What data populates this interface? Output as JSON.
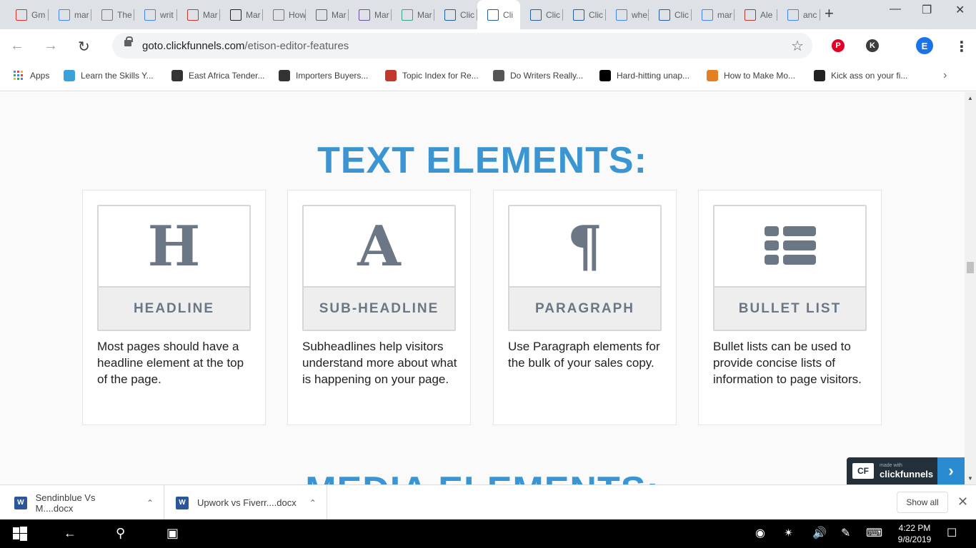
{
  "browser": {
    "tabs": [
      {
        "label": "Gm",
        "icon": "gmail-icon",
        "color": "#d93025"
      },
      {
        "label": "mar",
        "icon": "google-icon",
        "color": "#4285f4"
      },
      {
        "label": "The",
        "icon": "page-icon",
        "color": "#777777"
      },
      {
        "label": "writ",
        "icon": "google-icon",
        "color": "#4285f4"
      },
      {
        "label": "Mar",
        "icon": "site-icon",
        "color": "#c0392b"
      },
      {
        "label": "Mar",
        "icon": "site-icon",
        "color": "#222222"
      },
      {
        "label": "How",
        "icon": "page-icon",
        "color": "#777777"
      },
      {
        "label": "Mar",
        "icon": "globe-icon",
        "color": "#5f6368"
      },
      {
        "label": "Mar",
        "icon": "site-icon",
        "color": "#6b4fa0"
      },
      {
        "label": "Mar",
        "icon": "site-icon",
        "color": "#3aa28a"
      },
      {
        "label": "Clic",
        "icon": "clickfunnels-icon",
        "color": "#1f5fa8"
      },
      {
        "label": "Cli",
        "icon": "clickfunnels-icon",
        "color": "#1f5fa8",
        "active": true
      },
      {
        "label": "Clic",
        "icon": "clickfunnels-icon",
        "color": "#1f5fa8"
      },
      {
        "label": "Clic",
        "icon": "clickfunnels-icon",
        "color": "#1f5fa8"
      },
      {
        "label": "whe",
        "icon": "google-icon",
        "color": "#4285f4"
      },
      {
        "label": "Clic",
        "icon": "clickfunnels-icon",
        "color": "#1f5fa8"
      },
      {
        "label": "mar",
        "icon": "google-icon",
        "color": "#4285f4"
      },
      {
        "label": "Ale",
        "icon": "site-icon",
        "color": "#b03a2e"
      },
      {
        "label": "anc",
        "icon": "google-icon",
        "color": "#4285f4"
      }
    ],
    "url_domain": "goto.clickfunnels.com",
    "url_path": "/etison-editor-features",
    "profile_initial": "E",
    "ext_initial": "K"
  },
  "bookmarks": [
    {
      "label": "Apps",
      "icon": "apps-grid-icon",
      "color": "#4285f4"
    },
    {
      "label": "Learn the Skills Y...",
      "icon": "site-icon",
      "color": "#3aa2d8"
    },
    {
      "label": "East Africa Tender...",
      "icon": "site-icon",
      "color": "#333333"
    },
    {
      "label": "Importers Buyers...",
      "icon": "site-icon",
      "color": "#333333"
    },
    {
      "label": "Topic Index for Re...",
      "icon": "site-icon",
      "color": "#c0392b"
    },
    {
      "label": "Do Writers Really...",
      "icon": "clock-icon",
      "color": "#555555"
    },
    {
      "label": "Hard-hitting unap...",
      "icon": "m-icon",
      "color": "#000000"
    },
    {
      "label": "How to Make Mo...",
      "icon": "site-icon",
      "color": "#e67e22"
    },
    {
      "label": "Kick ass on your fi...",
      "icon": "site-icon",
      "color": "#222222"
    }
  ],
  "page": {
    "section_title": "TEXT ELEMENTS:",
    "next_section_title": "MEDIA ELEMENTS:",
    "cards": [
      {
        "glyph": "H",
        "label": "HEADLINE",
        "desc": "Most pages should have a headline element at the top of the page."
      },
      {
        "glyph": "A",
        "label": "SUB-HEADLINE",
        "desc": "Subheadlines help visitors understand more about what is happening on your page."
      },
      {
        "glyph": "¶",
        "label": "PARAGRAPH",
        "desc": "Use Paragraph elements for the bulk of your sales copy."
      },
      {
        "glyph": "list",
        "label": "BULLET LIST",
        "desc": "Bullet lists can be used to provide concise lists of information to page visitors."
      }
    ],
    "badge_made": "made with",
    "badge_name": "clickfunnels"
  },
  "downloads": {
    "items": [
      {
        "name": "Sendinblue Vs M....docx"
      },
      {
        "name": "Upwork vs Fiverr....docx"
      }
    ],
    "show_all": "Show all"
  },
  "taskbar": {
    "time": "4:22 PM",
    "date": "9/8/2019"
  }
}
